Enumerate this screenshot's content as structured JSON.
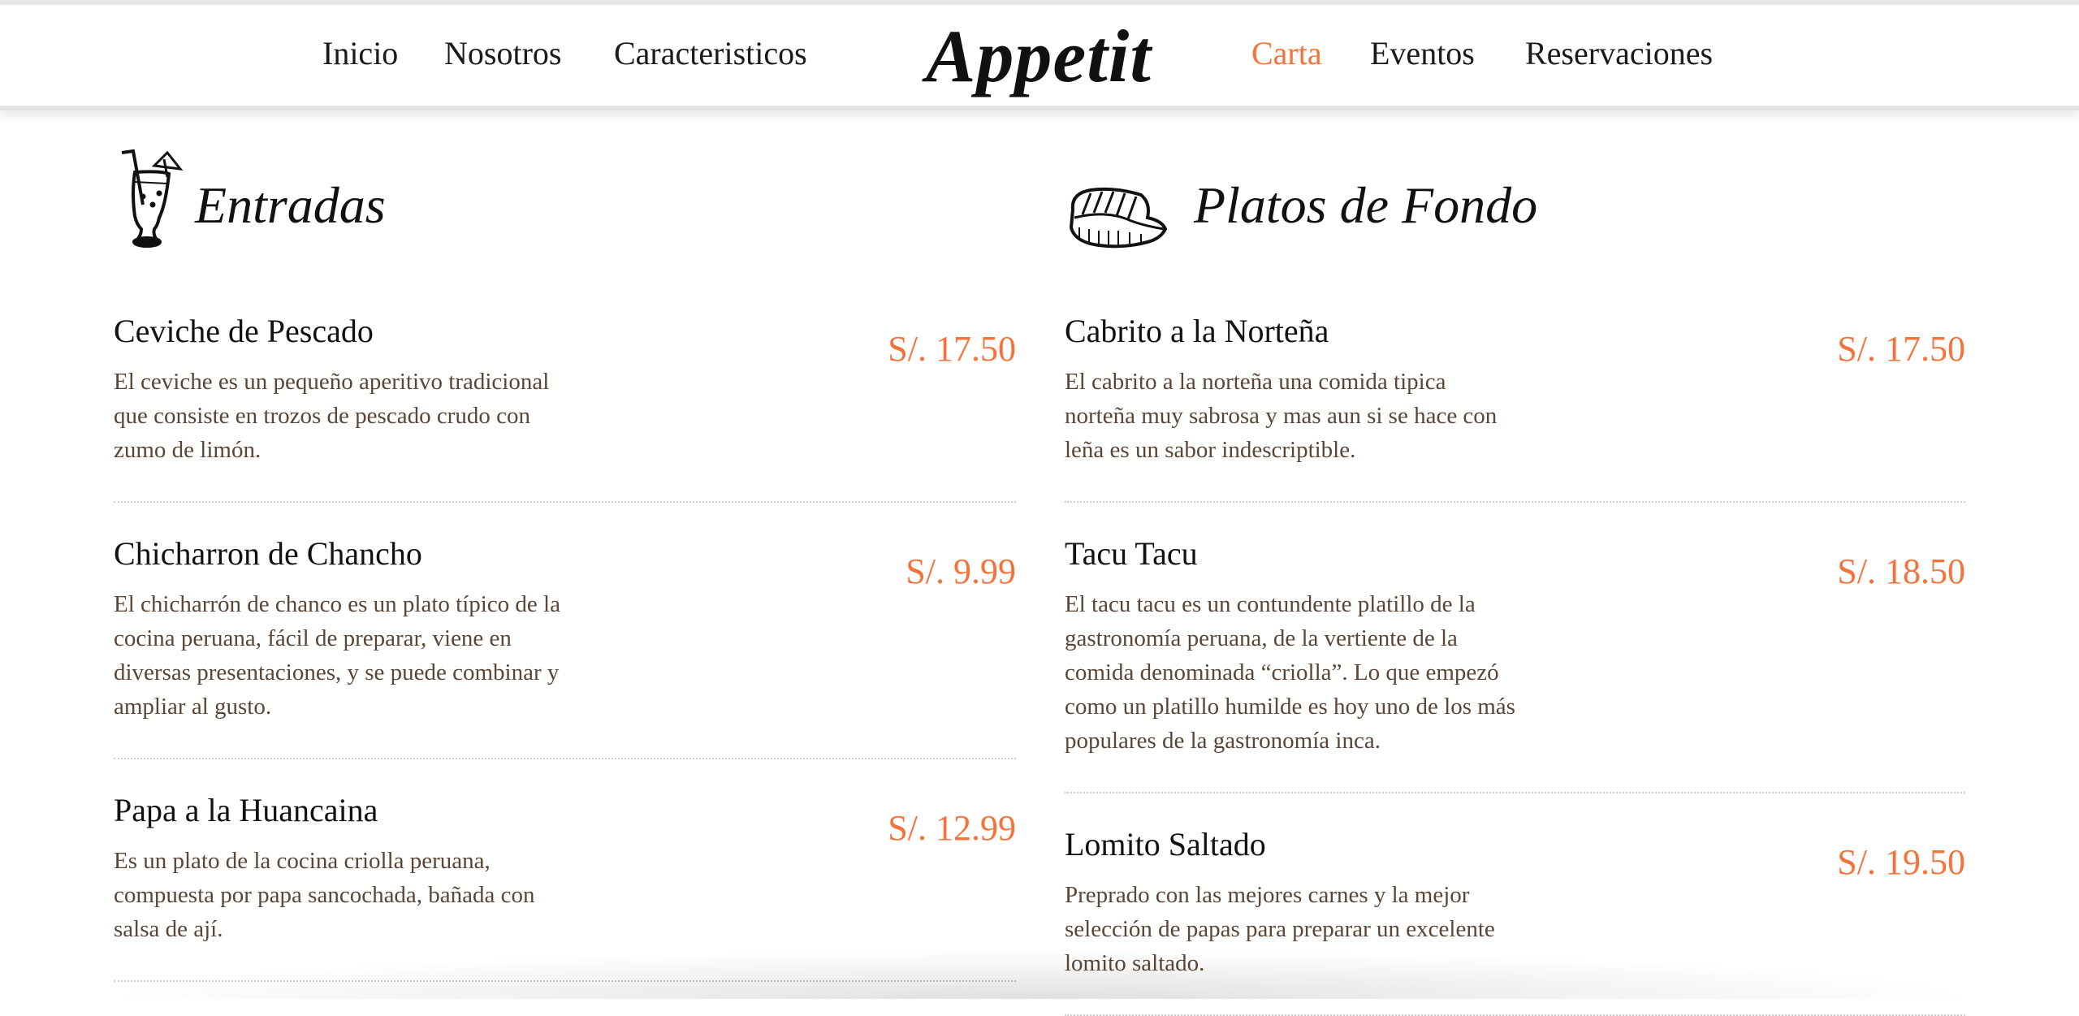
{
  "nav": {
    "left": [
      "Inicio",
      "Nosotros",
      "Caracteristicos"
    ],
    "logo": "Appetit",
    "right": [
      "Carta",
      "Eventos",
      "Reservaciones"
    ],
    "active": "Carta"
  },
  "colors": {
    "accent": "#f5733a",
    "description": "#5b4636"
  },
  "sections": [
    {
      "title": "Entradas",
      "icon": "cocktail-icon",
      "items": [
        {
          "name": "Ceviche de Pescado",
          "price": "S/. 17.50",
          "description": "El ceviche es un pequeño aperitivo tradicional\nque consiste en trozos de pescado crudo con\nzumo de limón."
        },
        {
          "name": "Chicharron de Chancho",
          "price": "S/. 9.99",
          "description": "El chicharrón de chanco es un plato típico de la\ncocina peruana, fácil de preparar, viene en\ndiversas presentaciones, y se puede combinar y\nampliar al gusto."
        },
        {
          "name": "Papa a la Huancaina",
          "price": "S/. 12.99",
          "description": "Es un plato de la cocina criolla peruana,\ncompuesta por papa sancochada, bañada con\nsalsa de ají."
        }
      ]
    },
    {
      "title": "Platos de Fondo",
      "icon": "steak-icon",
      "items": [
        {
          "name": "Cabrito a la Norteña",
          "price": "S/. 17.50",
          "description": "El cabrito a la norteña una comida tipica\nnorteña muy sabrosa y mas aun si se hace con\nleña es un sabor indescriptible."
        },
        {
          "name": "Tacu Tacu",
          "price": "S/. 18.50",
          "description": "El tacu tacu es un contundente platillo de la\ngastronomía peruana, de la vertiente de la\ncomida denominada “criolla”. Lo que empezó\ncomo un platillo humilde es hoy uno de los más\npopulares de la gastronomía inca."
        },
        {
          "name": "Lomito Saltado",
          "price": "S/. 19.50",
          "description": "Preprado con las mejores carnes y la mejor\nselección de papas para preparar un excelente\nlomito saltado."
        }
      ]
    }
  ]
}
